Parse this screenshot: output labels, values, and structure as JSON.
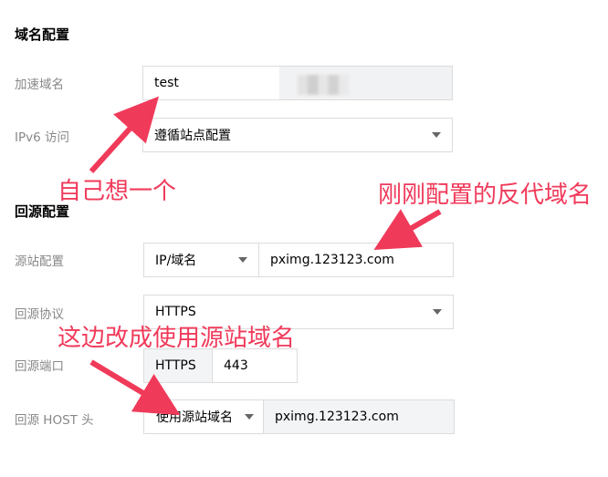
{
  "domain_section": {
    "title": "域名配置",
    "accel_domain_label": "加速域名",
    "accel_domain_value": "test",
    "ipv6_label": "IPv6 访问",
    "ipv6_value": "遵循站点配置"
  },
  "origin_section": {
    "title": "回源配置",
    "origin_config_label": "源站配置",
    "origin_type_value": "IP/域名",
    "origin_address_value": "pximg.123123.com",
    "protocol_label": "回源协议",
    "protocol_value": "HTTPS",
    "port_label": "回源端口",
    "port_prefix": "HTTPS",
    "port_value": "443",
    "host_label": "回源 HOST 头",
    "host_type_value": "使用源站域名",
    "host_value": "pximg.123123.com"
  },
  "annotations": {
    "note_self": "自己想一个",
    "note_proxy_domain": "刚刚配置的反代域名",
    "note_change": "这边改成使用源站域名",
    "color": "#f03a5a"
  }
}
